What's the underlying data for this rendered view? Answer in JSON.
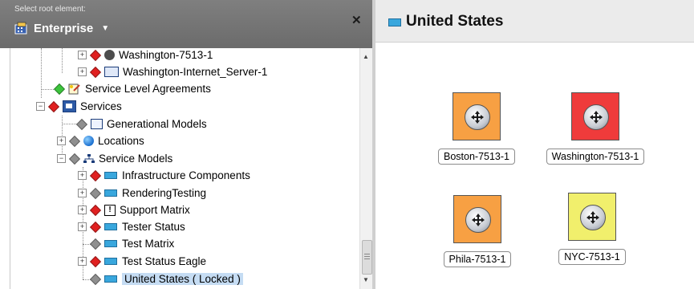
{
  "left_panel": {
    "caption": "Select root element:",
    "root_selector": "Enterprise",
    "close_glyph": "✕",
    "tree_items": [
      {
        "label": "Washington-7513-1",
        "icon": "router-icon",
        "status": "red"
      },
      {
        "label": "Washington-Internet_Server-1",
        "icon": "server-icon",
        "status": "red"
      },
      {
        "label": "Service Level Agreements",
        "icon": "sla-icon",
        "status": "green"
      },
      {
        "label": "Services",
        "icon": "services-icon",
        "status": "red"
      },
      {
        "label": "Generational Models",
        "icon": "generational-models-icon",
        "status": "gray"
      },
      {
        "label": "Locations",
        "icon": "globe-icon",
        "status": "gray"
      },
      {
        "label": "Service Models",
        "icon": "network-icon",
        "status": "red"
      },
      {
        "label": "Infrastructure Components",
        "icon": "service-model-icon",
        "status": "red"
      },
      {
        "label": "RenderingTesting",
        "icon": "service-model-icon",
        "status": "gray"
      },
      {
        "label": "Support Matrix",
        "icon": "exclamation-icon",
        "status": "red"
      },
      {
        "label": "Tester Status",
        "icon": "service-model-icon",
        "status": "red"
      },
      {
        "label": "Test Matrix",
        "icon": "service-model-icon",
        "status": "gray"
      },
      {
        "label": "Test Status Eagle",
        "icon": "service-model-icon",
        "status": "red"
      },
      {
        "label": "United States ( Locked )",
        "icon": "service-model-icon",
        "status": "gray"
      }
    ]
  },
  "right_panel": {
    "title": "United States",
    "nodes": [
      {
        "label": "Boston-7513-1",
        "color": "#f7a043"
      },
      {
        "label": "Washington-7513-1",
        "color": "#ef3b3b"
      },
      {
        "label": "Phila-7513-1",
        "color": "#f7a043"
      },
      {
        "label": "NYC-7513-1",
        "color": "#f1ef6c"
      }
    ]
  },
  "colors": {
    "status_red": "#e02020",
    "status_green": "#3cc43c",
    "status_gray": "#8f8f8f",
    "selection": "#c5dcf3"
  }
}
